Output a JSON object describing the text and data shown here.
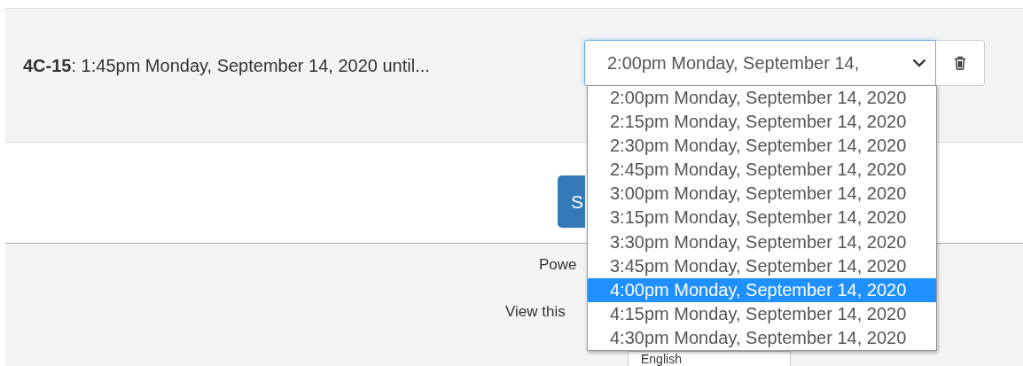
{
  "slot": {
    "text": "**4C-15**: 1:45pm Monday, September 14, 2020 until...",
    "select": {
      "value": "2:00pm Monday, September 14,",
      "expanded": true,
      "options": [
        {
          "label": "2:00pm Monday, September 14, 2020",
          "selected": false
        },
        {
          "label": "2:15pm Monday, September 14, 2020",
          "selected": false
        },
        {
          "label": "2:30pm Monday, September 14, 2020",
          "selected": false
        },
        {
          "label": "2:45pm Monday, September 14, 2020",
          "selected": false
        },
        {
          "label": "3:00pm Monday, September 14, 2020",
          "selected": false
        },
        {
          "label": "3:15pm Monday, September 14, 2020",
          "selected": false
        },
        {
          "label": "3:30pm Monday, September 14, 2020",
          "selected": false
        },
        {
          "label": "3:45pm Monday, September 14, 2020",
          "selected": false
        },
        {
          "label": "4:00pm Monday, September 14, 2020",
          "selected": true
        },
        {
          "label": "4:15pm Monday, September 14, 2020",
          "selected": false
        },
        {
          "label": "4:30pm Monday, September 14, 2020",
          "selected": false
        }
      ]
    }
  },
  "submit_button": {
    "label": "S"
  },
  "footer": {
    "powered": "Powe",
    "view": "View this",
    "language_select": {
      "value": "English"
    }
  }
}
